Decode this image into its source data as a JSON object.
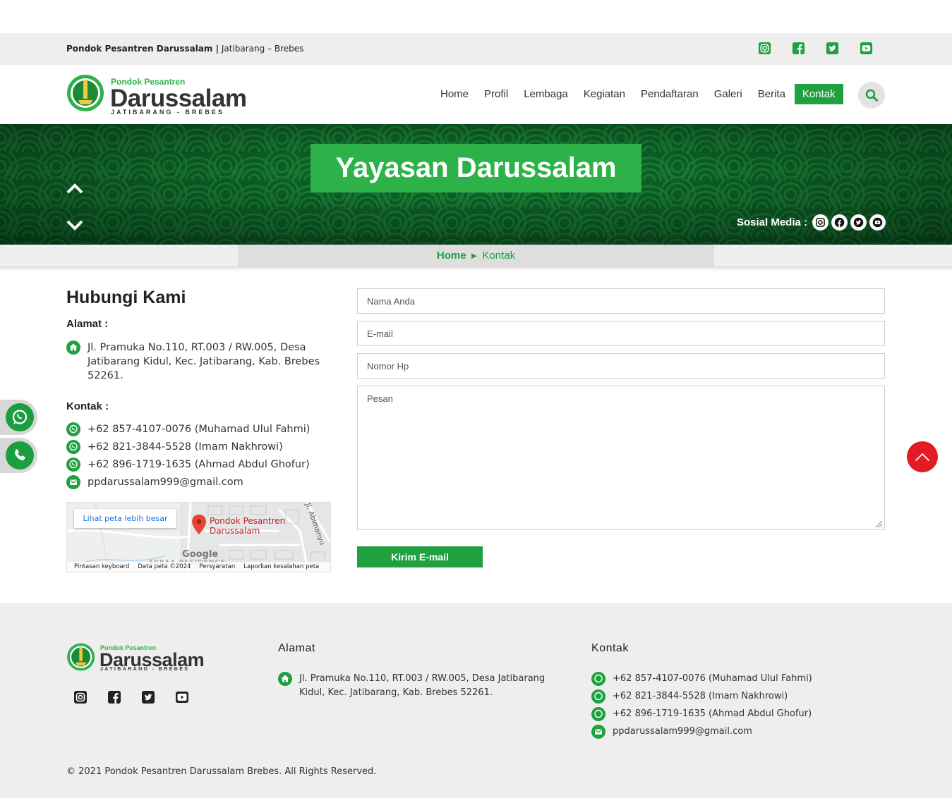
{
  "topbar": {
    "brand": "Pondok Pesantren Darussalam |",
    "location": "Jatibarang – Brebes",
    "icons": [
      "instagram-icon",
      "facebook-icon",
      "twitter-icon",
      "youtube-icon"
    ]
  },
  "logo": {
    "line1": "Pondok Pesantren",
    "line2": "Darussalam",
    "line3": "JATIBARANG - BREBES"
  },
  "nav": {
    "items": [
      "Home",
      "Profil",
      "Lembaga",
      "Kegiatan",
      "Pendaftaran",
      "Galeri",
      "Berita",
      "Kontak"
    ],
    "active": "Kontak"
  },
  "hero": {
    "title": "Yayasan Darussalam",
    "social_label": "Sosial Media :"
  },
  "breadcrumb": {
    "home": "Home",
    "separator": "►",
    "current": "Kontak"
  },
  "contact": {
    "heading": "Hubungi Kami",
    "address_label": "Alamat :",
    "address": "Jl. Pramuka No.110, RT.003 / RW.005, Desa Jatibarang Kidul, Kec. Jatibarang, Kab. Brebes 52261.",
    "contact_label": "Kontak :",
    "phones": [
      "+62 857-4107-0076 (Muhamad Ulul Fahmi)",
      "+62 821-3844-5528 (Imam Nakhrowi)",
      "+62 896-1719-1635 (Ahmad Abdul Ghofur)"
    ],
    "email": "ppdarussalam999@gmail.com"
  },
  "map": {
    "larger_map": "Lihat peta lebih besar",
    "pin_label_1": "Pondok Pesantren",
    "pin_label_2": "Darussalam",
    "street": "Jl. Abimanyu",
    "google": "Google",
    "area": "ARRAA RESIDENCE",
    "footer": [
      "Pintasan keyboard",
      "Data peta ©2024",
      "Persyaratan",
      "Laporkan kesalahan peta"
    ]
  },
  "form": {
    "name_placeholder": "Nama Anda",
    "email_placeholder": "E-mail",
    "phone_placeholder": "Nomor Hp",
    "message_placeholder": "Pesan",
    "submit": "Kirim E-mail"
  },
  "footer": {
    "address_heading": "Alamat",
    "address": "Jl. Pramuka No.110, RT.003 / RW.005, Desa Jatibarang Kidul, Kec. Jatibarang, Kab. Brebes 52261.",
    "contact_heading": "Kontak",
    "phones": [
      "+62 857-4107-0076 (Muhamad Ulul Fahmi)",
      "+62 821-3844-5528 (Imam Nakhrowi)",
      "+62 896-1719-1635 (Ahmad Abdul Ghofur)"
    ],
    "email": "ppdarussalam999@gmail.com",
    "copyright": "© 2021 Pondok Pesantren Darussalam Brebes. All Rights Reserved."
  },
  "colors": {
    "green": "#1fa140",
    "title_green": "#2db24a",
    "red": "#e31b23"
  }
}
